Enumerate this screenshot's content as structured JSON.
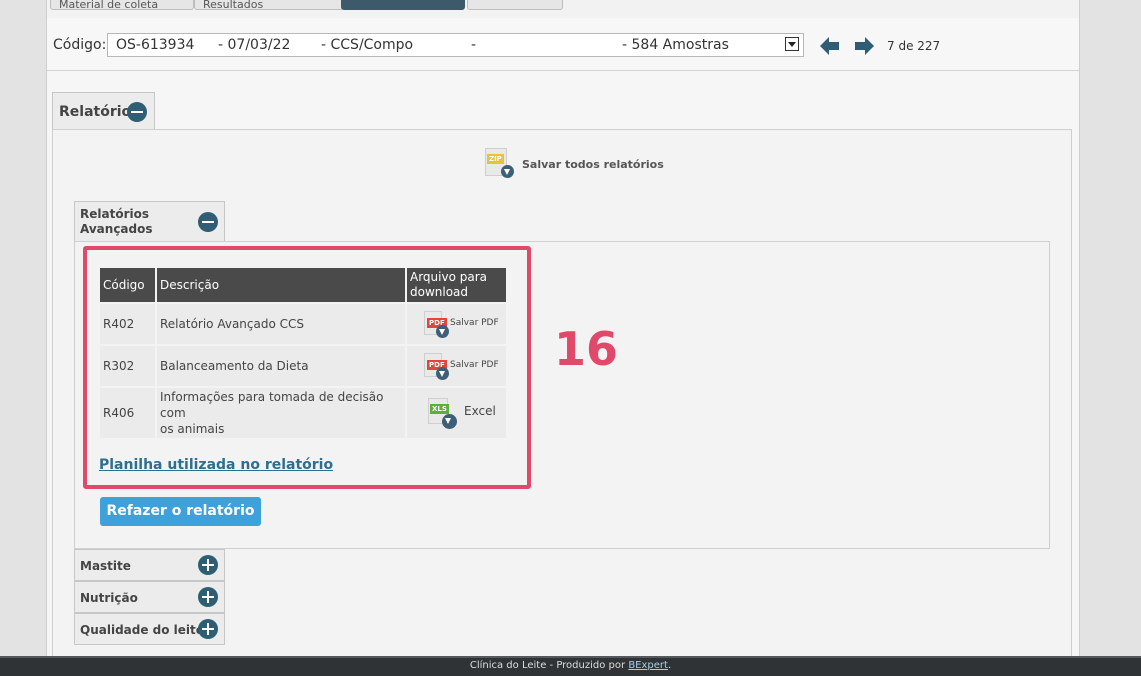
{
  "top_tabs": [
    "Material de coleta",
    "Resultados"
  ],
  "code_bar": {
    "label": "Código:",
    "order": "OS-613934",
    "date": "- 07/03/22",
    "type": "- CCS/Compo",
    "dash": "-",
    "samples": "- 584 Amostras",
    "counter": "7 de 227"
  },
  "reports_section": {
    "title": "Relatórios",
    "save_all": "Salvar todos relatórios"
  },
  "advanced": {
    "title_line1": "Relatórios",
    "title_line2": "Avançados",
    "headers": {
      "code": "Código",
      "description": "Descrição",
      "file_line1": "Arquivo para",
      "file_line2": "download"
    },
    "rows": [
      {
        "code": "R402",
        "description": "Relatório Avançado CCS",
        "download": "Salvar PDF",
        "badge": "PDF"
      },
      {
        "code": "R302",
        "description": "Balanceamento da Dieta",
        "download": "Salvar PDF",
        "badge": "PDF"
      },
      {
        "code": "R406",
        "description_line1": "Informações para tomada de decisão com",
        "description_line2": "os animais",
        "download": "Excel",
        "badge": "XLS"
      }
    ],
    "spreadsheet_link": "Planilha utilizada no relatório",
    "redo_button": "Refazer o relatório"
  },
  "annotation_number": "16",
  "accordion": [
    "Mastite",
    "Nutrição",
    "Qualidade do leite"
  ],
  "footer": {
    "text": "Clínica do Leite - Produzido por",
    "link": "BExpert",
    "end": "."
  },
  "colors": {
    "highlight": "#e04a6a",
    "button": "#3ea1d9",
    "header": "#4a4a4a",
    "accent": "#2f5d73"
  }
}
